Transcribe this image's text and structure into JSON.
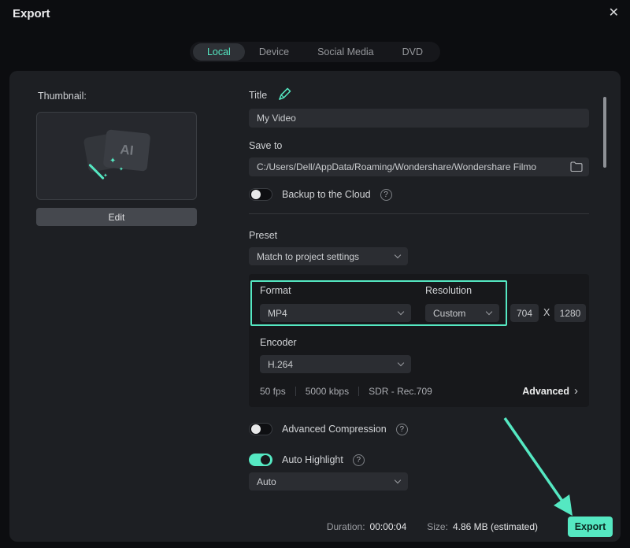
{
  "dialog": {
    "title": "Export"
  },
  "icons": {
    "close": "✕",
    "help": "?",
    "advanced_chevron": "›",
    "ai_card_label": "AI",
    "sparkle": "✦"
  },
  "tabs": {
    "items": [
      {
        "label": "Local",
        "active": true
      },
      {
        "label": "Device",
        "active": false
      },
      {
        "label": "Social Media",
        "active": false
      },
      {
        "label": "DVD",
        "active": false
      }
    ]
  },
  "left": {
    "thumbnail_label": "Thumbnail:",
    "edit_button": "Edit"
  },
  "form": {
    "title_label": "Title",
    "title_value": "My Video",
    "save_to_label": "Save to",
    "save_to_value": "C:/Users/Dell/AppData/Roaming/Wondershare/Wondershare Filmo",
    "backup_label": "Backup to the Cloud",
    "preset_label": "Preset",
    "preset_value": "Match to project settings",
    "format_label": "Format",
    "format_value": "MP4",
    "resolution_label": "Resolution",
    "resolution_value": "Custom",
    "width_value": "704",
    "dimension_x": "X",
    "height_value": "1280",
    "encoder_label": "Encoder",
    "encoder_value": "H.264",
    "fps": "50 fps",
    "bitrate": "5000 kbps",
    "color_space": "SDR - Rec.709",
    "advanced_label": "Advanced",
    "advanced_compression_label": "Advanced Compression",
    "auto_highlight_label": "Auto Highlight",
    "auto_highlight_value": "Auto"
  },
  "toggles": {
    "backup_to_cloud": false,
    "advanced_compression": false,
    "auto_highlight": true
  },
  "footer": {
    "duration_label": "Duration:",
    "duration_value": "00:00:04",
    "size_label": "Size:",
    "size_value": "4.86 MB  (estimated)",
    "export_button": "Export"
  },
  "colors": {
    "accent": "#55e8c2",
    "panel_bg": "#1d1f23",
    "page_bg": "#0c0d10"
  }
}
